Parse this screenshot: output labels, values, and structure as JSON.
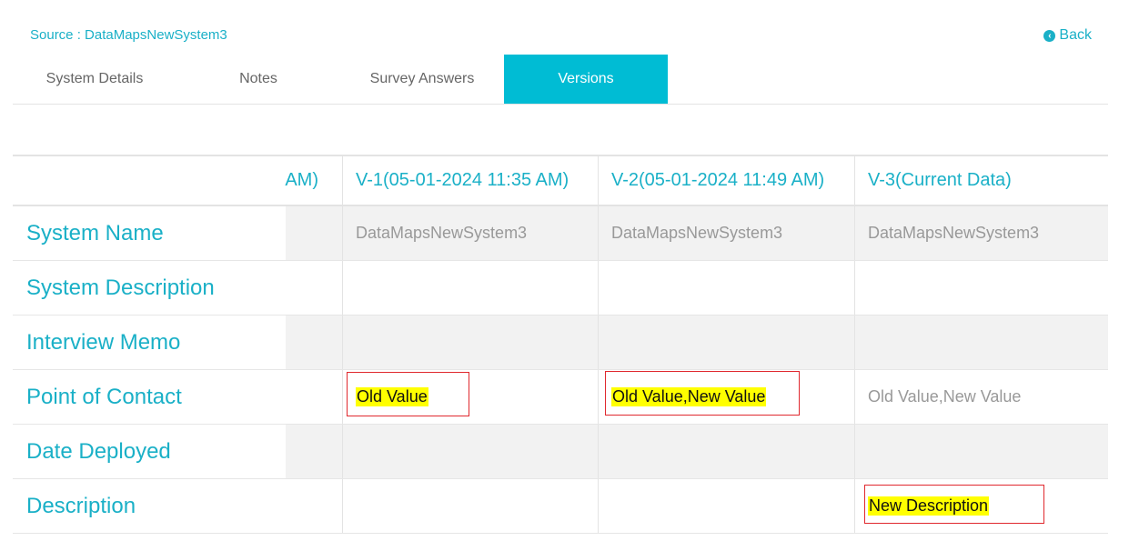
{
  "source": {
    "label": "Source : DataMapsNewSystem3"
  },
  "back": {
    "label": "Back"
  },
  "tabs": [
    {
      "label": "System Details"
    },
    {
      "label": "Notes"
    },
    {
      "label": "Survey Answers"
    },
    {
      "label": "Versions",
      "active": true
    }
  ],
  "table": {
    "headers": {
      "partial": "AM)",
      "v1": "V-1(05-01-2024 11:35 AM)",
      "v2": "V-2(05-01-2024 11:49 AM)",
      "v3": "V-3(Current Data)"
    },
    "rows": [
      {
        "label": "System Name",
        "v1": "DataMapsNewSystem3",
        "v2": "DataMapsNewSystem3",
        "v3": "DataMapsNewSystem3"
      },
      {
        "label": "System Description",
        "v1": "",
        "v2": "",
        "v3": ""
      },
      {
        "label": "Interview Memo",
        "v1": "",
        "v2": "",
        "v3": ""
      },
      {
        "label": "Point of Contact",
        "v1": "Old Value",
        "v2": "Old Value,New Value",
        "v3": "Old Value,New Value"
      },
      {
        "label": "Date Deployed",
        "v1": "",
        "v2": "",
        "v3": ""
      },
      {
        "label": "Description",
        "v1": "",
        "v2": "",
        "v3": "New Description"
      }
    ]
  },
  "colors": {
    "accent": "#00bcd4",
    "text_accent": "#1ab0c7",
    "highlight": "#ffff00",
    "highlight_border": "#e0282e"
  }
}
